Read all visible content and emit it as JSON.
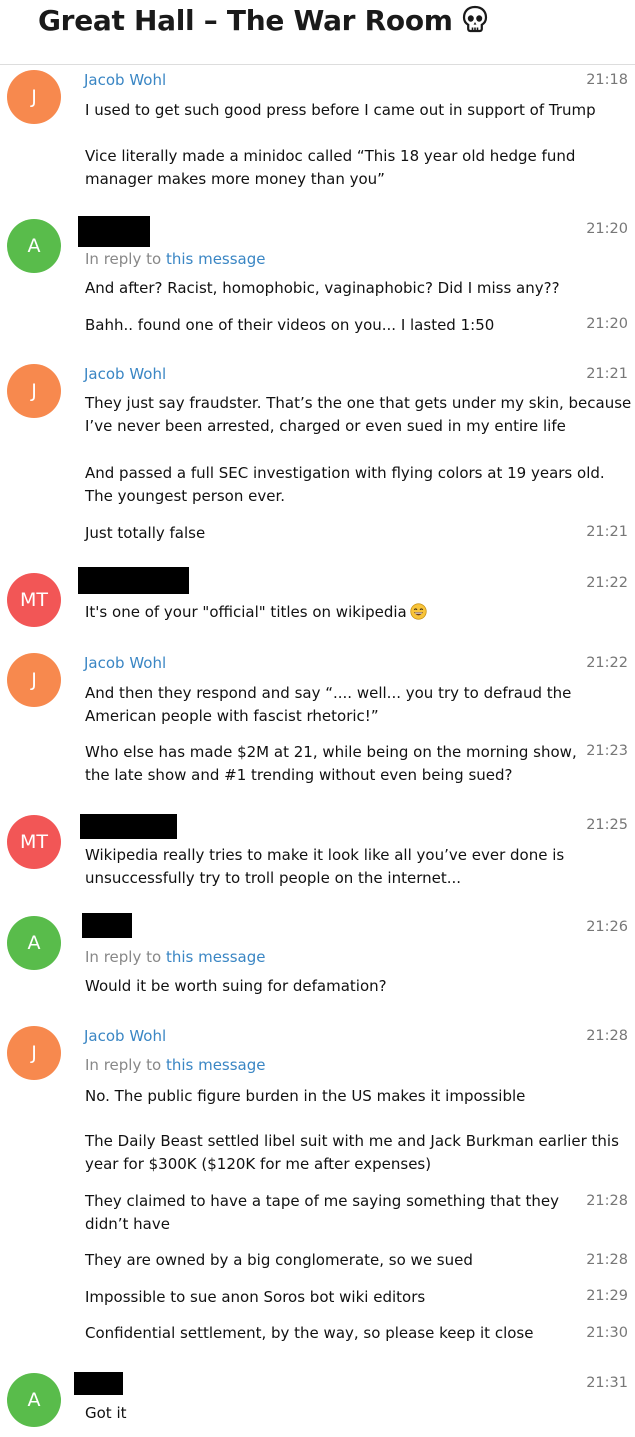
{
  "header": {
    "title": "Great Hall – The War Room"
  },
  "link_text": "this message",
  "reply_prefix": "In reply to ",
  "messages": [
    {
      "initials": "J",
      "sender": "Jacob Wohl",
      "time": "21:18",
      "texts": [
        "I used to get such good press before I came out in support of Trump",
        "Vice literally made a minidoc called “This 18 year old hedge fund manager makes more money than you”"
      ]
    },
    {
      "initials": "A",
      "time": "21:20",
      "texts": [
        "And after? Racist, homophobic, vaginaphobic? Did I miss any??"
      ],
      "followup": {
        "text": "Bahh.. found one of their videos on you... I lasted 1:50",
        "time": "21:20"
      }
    },
    {
      "initials": "J",
      "sender": "Jacob Wohl",
      "time": "21:21",
      "texts": [
        "They just say fraudster. That’s the one that gets under my skin, because I’ve never been arrested, charged or even sued in my entire life",
        "And passed a full SEC investigation with flying colors at 19 years old. The youngest person ever."
      ],
      "followup": {
        "text": "Just totally false",
        "time": "21:21"
      }
    },
    {
      "initials": "MT",
      "time": "21:22",
      "texts": [
        "It's one of your \"official\" titles on wikipedia"
      ]
    },
    {
      "initials": "J",
      "sender": "Jacob Wohl",
      "time": "21:22",
      "texts": [
        "And then they respond and say “.... well... you try to defraud the American people with fascist rhetoric!”"
      ],
      "followup": {
        "text": "Who else has made $2M at 21, while being on the morning show, the late show and #1 trending without even being sued?",
        "time": "21:23"
      }
    },
    {
      "initials": "MT",
      "time": "21:25",
      "texts": [
        "Wikipedia really tries to make it look like all you’ve ever done is unsuccessfully try to troll people on the internet..."
      ]
    },
    {
      "initials": "A",
      "time": "21:26",
      "texts": [
        "Would it be worth suing for defamation?"
      ]
    },
    {
      "initials": "J",
      "sender": "Jacob Wohl",
      "time": "21:28",
      "texts": [
        "No. The public figure burden in the US makes it impossible",
        "The Daily Beast settled libel suit with me and Jack Burkman earlier this year for $300K ($120K for me after expenses)"
      ],
      "followups": [
        {
          "text": "They claimed to have a tape of me saying something that they didn’t have",
          "time": "21:28"
        },
        {
          "text": "They are owned by a big conglomerate, so we sued",
          "time": "21:28"
        },
        {
          "text": "Impossible to sue anon Soros bot wiki editors",
          "time": "21:29"
        },
        {
          "text": "Confidential settlement, by the way, so please keep it close",
          "time": "21:30"
        }
      ]
    },
    {
      "initials": "A",
      "time": "21:31",
      "texts": [
        "Got it"
      ]
    }
  ]
}
